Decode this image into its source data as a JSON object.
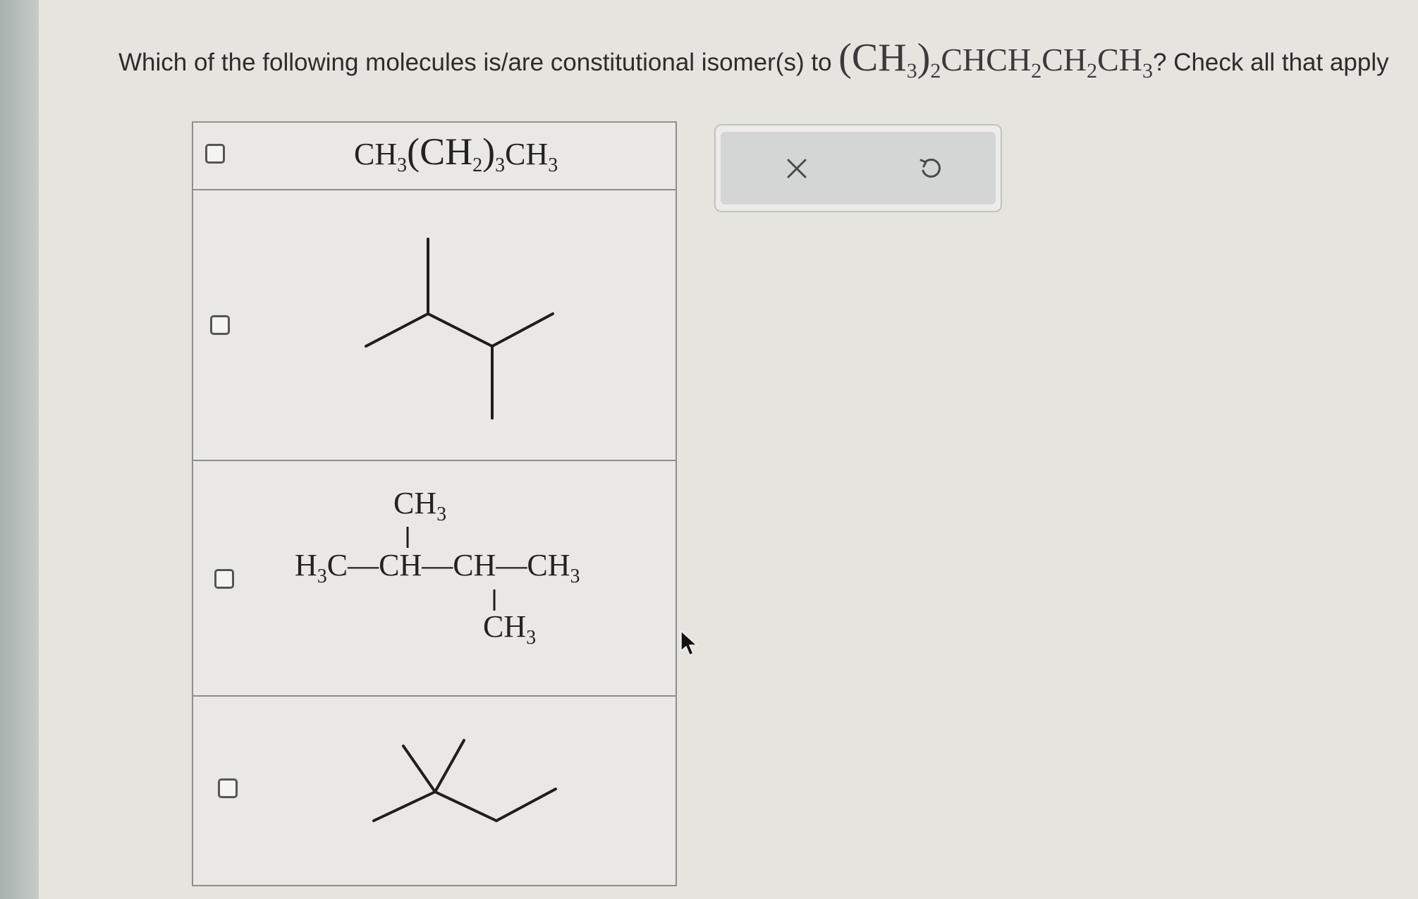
{
  "question": {
    "prefix": "Which of the following molecules is/are constitutional isomer(s) to ",
    "formula_parts": [
      "(CH",
      "3",
      ")",
      "2",
      "CHCH",
      "2",
      "CH",
      "2",
      "CH",
      "3"
    ],
    "suffix": "? Check all that apply"
  },
  "options": [
    {
      "type": "formula",
      "parts": [
        "CH",
        "3",
        "(CH",
        "2",
        ")",
        "3",
        "CH",
        "3"
      ],
      "checked": false
    },
    {
      "type": "skeletal",
      "icon": "skeletal-structure-2-3-dimethylbutane",
      "checked": false
    },
    {
      "type": "condensed",
      "top_group": [
        "CH",
        "3"
      ],
      "main_chain": [
        "H",
        "3",
        "C—CH—CH—CH",
        "3"
      ],
      "bottom_group": [
        "CH",
        "3"
      ],
      "checked": false
    },
    {
      "type": "skeletal",
      "icon": "skeletal-structure-2-2-dimethylbutane",
      "checked": false
    }
  ],
  "toolbar": {
    "clear_icon": "close-icon",
    "undo_icon": "undo-icon",
    "clear_glyph": "×",
    "undo_glyph": "↺"
  }
}
